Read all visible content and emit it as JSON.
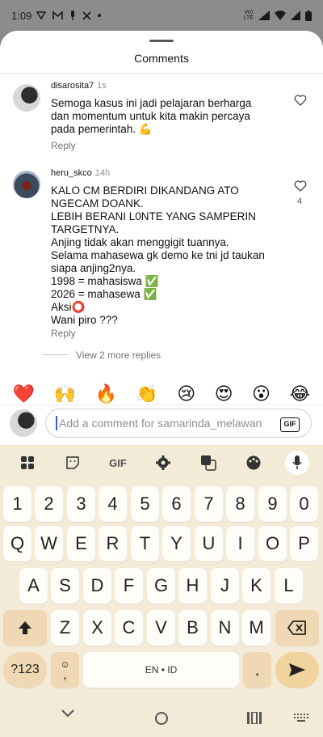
{
  "status": {
    "time": "1:09",
    "lte_top": "Vo)",
    "lte_bottom": "LTE"
  },
  "sheet": {
    "title": "Comments"
  },
  "comments": [
    {
      "username": "disarosita7",
      "time": "1s",
      "text": "Semoga kasus ini jadi pelajaran berharga\ndan momentum untuk kita makin percaya\npada pemerintah. 💪",
      "reply": "Reply",
      "likes": ""
    },
    {
      "username": "heru_skco",
      "time": "14h",
      "text": "KALO CM BERDIRI DIKANDANG ATO\nNGECAM DOANK.\nLEBIH BERANI L0NTE YANG SAMPERIN\nTARGETNYA.\nAnjing tidak akan menggigit tuannya.\nSelama mahasewa gk demo ke tni jd taukan\nsiapa anjing2nya.\n1998 = mahasiswa ✅\n2026 = mahasewa ✅\nAksi⭕\nWani piro ???",
      "reply": "Reply",
      "likes": "4"
    }
  ],
  "more_replies": "View 2 more replies",
  "quick_emojis": [
    "❤️",
    "🙌",
    "🔥",
    "👏",
    "😢",
    "😍",
    "😮",
    "😂"
  ],
  "input": {
    "placeholder": "Add a comment for samarinda_melawan",
    "gif_label": "GIF"
  },
  "keyboard": {
    "toolbar": {
      "gif": "GIF"
    },
    "row_numbers": [
      "1",
      "2",
      "3",
      "4",
      "5",
      "6",
      "7",
      "8",
      "9",
      "0"
    ],
    "row_top": [
      "Q",
      "W",
      "E",
      "R",
      "T",
      "Y",
      "U",
      "I",
      "O",
      "P"
    ],
    "row_mid": [
      "A",
      "S",
      "D",
      "F",
      "G",
      "H",
      "J",
      "K",
      "L"
    ],
    "row_bottom": [
      "Z",
      "X",
      "C",
      "V",
      "B",
      "N",
      "M"
    ],
    "symbols_key": "?123",
    "space_label": "EN • ID",
    "comma": ",",
    "period": "."
  }
}
